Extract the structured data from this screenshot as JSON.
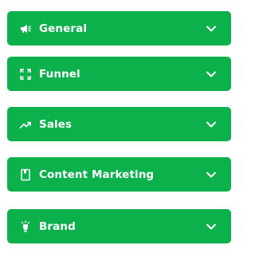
{
  "accordion": {
    "items": [
      {
        "label": "General",
        "icon": "megaphone-icon"
      },
      {
        "label": "Funnel",
        "icon": "expand-arrows-icon"
      },
      {
        "label": "Sales",
        "icon": "trending-up-icon"
      },
      {
        "label": "Content Marketing",
        "icon": "bookmark-book-icon"
      },
      {
        "label": "Brand",
        "icon": "lightbulb-icon"
      }
    ],
    "accent_color": "#0db14b",
    "text_color": "#ffffff",
    "state": "collapsed"
  }
}
